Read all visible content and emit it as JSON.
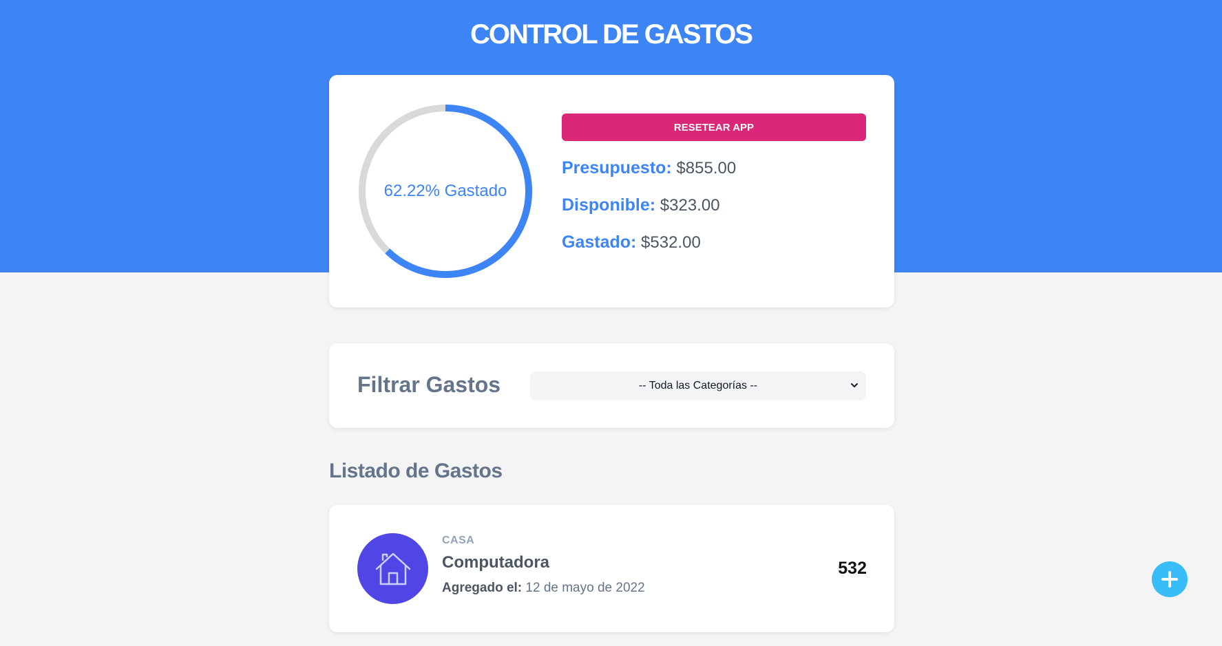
{
  "app": {
    "title": "CONTROL DE GASTOS"
  },
  "budget": {
    "percent_spent": 62.22,
    "ring_label": "62.22% Gastado",
    "reset_label": "RESETEAR APP",
    "presupuesto_label": "Presupuesto:",
    "presupuesto_value": "$855.00",
    "disponible_label": "Disponible:",
    "disponible_value": "$323.00",
    "gastado_label": "Gastado:",
    "gastado_value": "$532.00"
  },
  "filter": {
    "label": "Filtrar Gastos",
    "selected": "-- Toda las Categorías --"
  },
  "list": {
    "title": "Listado de Gastos",
    "items": [
      {
        "category": "CASA",
        "name": "Computadora",
        "date_label": "Agregado el:",
        "date": "12 de mayo de 2022",
        "amount": "532",
        "icon": "house-icon"
      }
    ]
  },
  "fab": {
    "icon": "plus-icon"
  },
  "colors": {
    "primary": "#3d84f5",
    "reset": "#db2777",
    "category_icon_bg": "#4f46e5",
    "fab": "#38bdf8",
    "ring_track": "#d9d9d9"
  }
}
